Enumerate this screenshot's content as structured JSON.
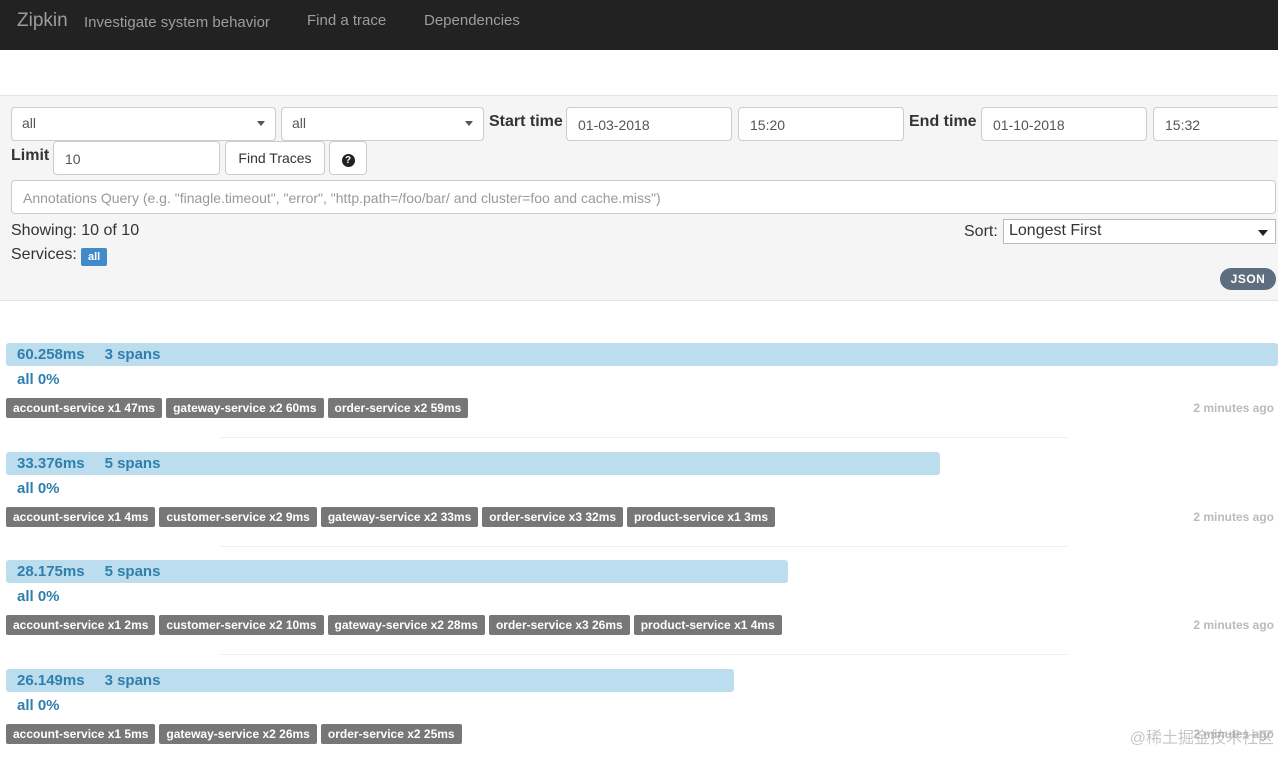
{
  "navbar": {
    "brand": "Zipkin",
    "tagline": "Investigate system behavior",
    "links": [
      "Find a trace",
      "Dependencies"
    ]
  },
  "form": {
    "service_select": "all",
    "span_select": "all",
    "start_time_label": "Start time",
    "start_date": "01-03-2018",
    "start_time": "15:20",
    "end_time_label": "End time",
    "end_date": "01-10-2018",
    "end_time": "15:32",
    "limit_label": "Limit",
    "limit_value": "10",
    "find_button": "Find Traces",
    "help_icon": "question-circle-icon",
    "annotations_placeholder": "Annotations Query (e.g. \"finagle.timeout\", \"error\", \"http.path=/foo/bar/ and cluster=foo and cache.miss\")"
  },
  "results": {
    "showing": "Showing: 10 of 10",
    "services_label": "Services:",
    "services_badge": "all",
    "sort_label": "Sort:",
    "sort_value": "Longest First",
    "json_button": "JSON"
  },
  "traces": [
    {
      "duration": "60.258ms",
      "spans": "3 spans",
      "width_pct": 100,
      "pct_label": "all 0%",
      "services": [
        "account-service x1 47ms",
        "gateway-service x2 60ms",
        "order-service x2 59ms"
      ],
      "ago": "2 minutes ago"
    },
    {
      "duration": "33.376ms",
      "spans": "5 spans",
      "width_pct": 73.4,
      "pct_label": "all 0%",
      "services": [
        "account-service x1 4ms",
        "customer-service x2 9ms",
        "gateway-service x2 33ms",
        "order-service x3 32ms",
        "product-service x1 3ms"
      ],
      "ago": "2 minutes ago"
    },
    {
      "duration": "28.175ms",
      "spans": "5 spans",
      "width_pct": 61.5,
      "pct_label": "all 0%",
      "services": [
        "account-service x1 2ms",
        "customer-service x2 10ms",
        "gateway-service x2 28ms",
        "order-service x3 26ms",
        "product-service x1 4ms"
      ],
      "ago": "2 minutes ago"
    },
    {
      "duration": "26.149ms",
      "spans": "3 spans",
      "width_pct": 57.2,
      "pct_label": "all 0%",
      "services": [
        "account-service x1 5ms",
        "gateway-service x2 26ms",
        "order-service x2 25ms"
      ],
      "ago": "2 minutes ago"
    }
  ],
  "watermark": "@稀土掘金技术社区"
}
